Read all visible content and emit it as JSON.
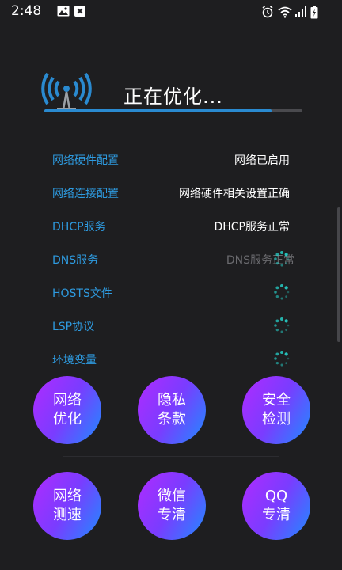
{
  "status_bar": {
    "time": "2:48"
  },
  "header": {
    "title": "正在优化...",
    "progress": 0.88
  },
  "rows": [
    {
      "label": "网络硬件配置",
      "status": "网络已启用",
      "state": "done"
    },
    {
      "label": "网络连接配置",
      "status": "网络硬件相关设置正确",
      "state": "done"
    },
    {
      "label": "DHCP服务",
      "status": "DHCP服务正常",
      "state": "done"
    },
    {
      "label": "DNS服务",
      "status": "DNS服务正常",
      "state": "loading"
    },
    {
      "label": "HOSTS文件",
      "status": "",
      "state": "loading"
    },
    {
      "label": "LSP协议",
      "status": "",
      "state": "loading"
    },
    {
      "label": "环境变量",
      "status": "",
      "state": "loading"
    }
  ],
  "buttons": {
    "network_optimize": "网络优化",
    "privacy_terms": "隐私条款",
    "security_check": "安全检测",
    "speed_test": "网络测速",
    "wechat_clean": "微信专清",
    "qq_clean": "QQ专清"
  },
  "colors": {
    "accent": "#2e9be0",
    "gradient_start": "#b02bff",
    "gradient_end": "#1e8cff",
    "background": "#1e1e20"
  }
}
